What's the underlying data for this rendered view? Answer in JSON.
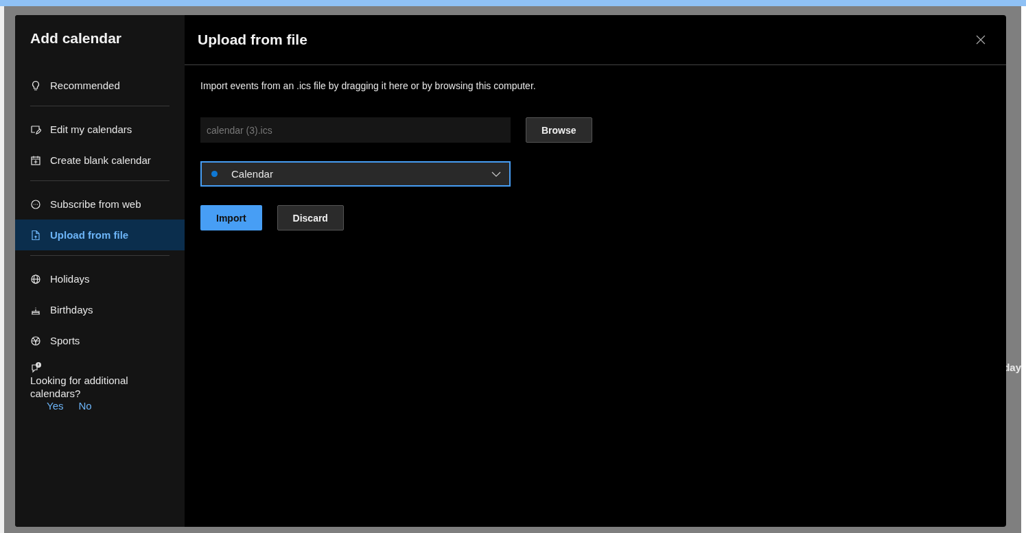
{
  "backdrop": {
    "fragment": "day"
  },
  "dialog": {
    "sidebar": {
      "title": "Add calendar",
      "groups": [
        [
          {
            "label": "Recommended",
            "selected": false
          }
        ],
        [
          {
            "label": "Edit my calendars",
            "selected": false
          },
          {
            "label": "Create blank calendar",
            "selected": false
          }
        ],
        [
          {
            "label": "Subscribe from web",
            "selected": false
          },
          {
            "label": "Upload from file",
            "selected": true
          }
        ],
        [
          {
            "label": "Holidays",
            "selected": false
          },
          {
            "label": "Birthdays",
            "selected": false
          },
          {
            "label": "Sports",
            "selected": false
          }
        ]
      ],
      "feedback": {
        "question": "Looking for additional calendars?",
        "answers": [
          "Yes",
          "No"
        ]
      }
    },
    "main": {
      "title": "Upload from file",
      "description": "Import events from an .ics file by dragging it here or by browsing this computer.",
      "file_field": {
        "value": "calendar (3).ics"
      },
      "browse_button": "Browse",
      "calendar_select": {
        "value": "Calendar",
        "color": "#0f78d4"
      },
      "buttons": [
        {
          "label": "Import",
          "kind": "primary"
        },
        {
          "label": "Discard",
          "kind": "secondary"
        }
      ]
    }
  }
}
